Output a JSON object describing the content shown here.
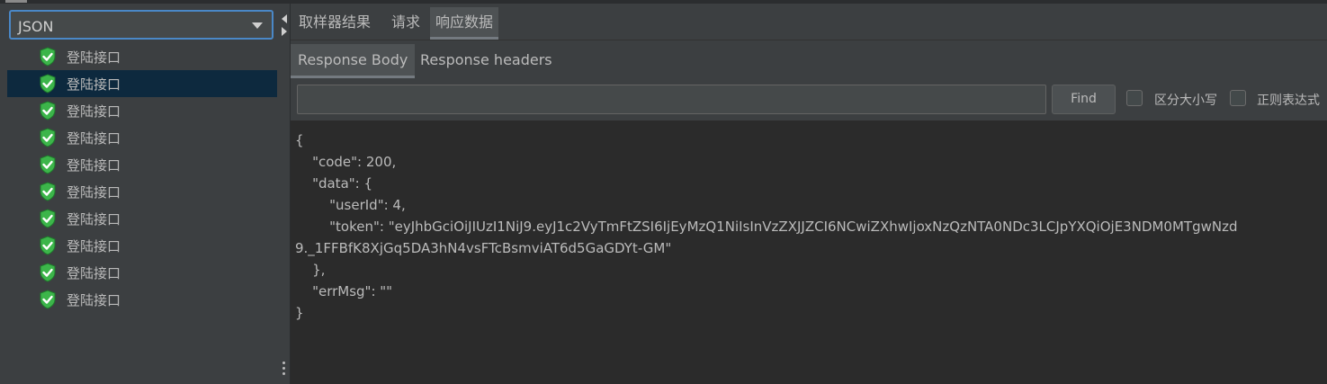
{
  "sampler_tree": {
    "view_mode": "JSON",
    "items": [
      {
        "label": "登陆接口",
        "selected": false
      },
      {
        "label": "登陆接口",
        "selected": true
      },
      {
        "label": "登陆接口",
        "selected": false
      },
      {
        "label": "登陆接口",
        "selected": false
      },
      {
        "label": "登陆接口",
        "selected": false
      },
      {
        "label": "登陆接口",
        "selected": false
      },
      {
        "label": "登陆接口",
        "selected": false
      },
      {
        "label": "登陆接口",
        "selected": false
      },
      {
        "label": "登陆接口",
        "selected": false
      },
      {
        "label": "登陆接口",
        "selected": false
      }
    ],
    "status_icon": "green-shield-check-icon"
  },
  "result_tabs": [
    {
      "label": "取样器结果",
      "active": false
    },
    {
      "label": "请求",
      "active": false
    },
    {
      "label": "响应数据",
      "active": true
    }
  ],
  "response_tabs": [
    {
      "label": "Response Body",
      "active": true
    },
    {
      "label": "Response headers",
      "active": false
    }
  ],
  "search": {
    "value": "",
    "find_label": "Find",
    "case_sensitive_label": "区分大小写",
    "regex_label": "正则表达式",
    "case_sensitive_checked": false,
    "regex_checked": false
  },
  "response_body": {
    "lines": [
      "{",
      "    \"code\": 200,",
      "    \"data\": {",
      "        \"userId\": 4,",
      "        \"token\": \"eyJhbGciOiJIUzI1NiJ9.eyJ1c2VyTmFtZSI6IjEyMzQ1NiIsInVzZXJJZCI6NCwiZXhwIjoxNzQzNTA0NDc3LCJpYXQiOjE3NDM0MTgwNzd",
      "9._1FFBfK8XjGq5DA3hN4vsFTcBsmviAT6d5GaGDYt-GM\"",
      "    },",
      "    \"errMsg\": \"\"",
      "}"
    ]
  },
  "colors": {
    "background": "#3c3f41",
    "editor_background": "#2b2b2b",
    "selection": "#0d293e",
    "focus_border": "#4a88c7",
    "success_icon": "#3cb54a"
  }
}
